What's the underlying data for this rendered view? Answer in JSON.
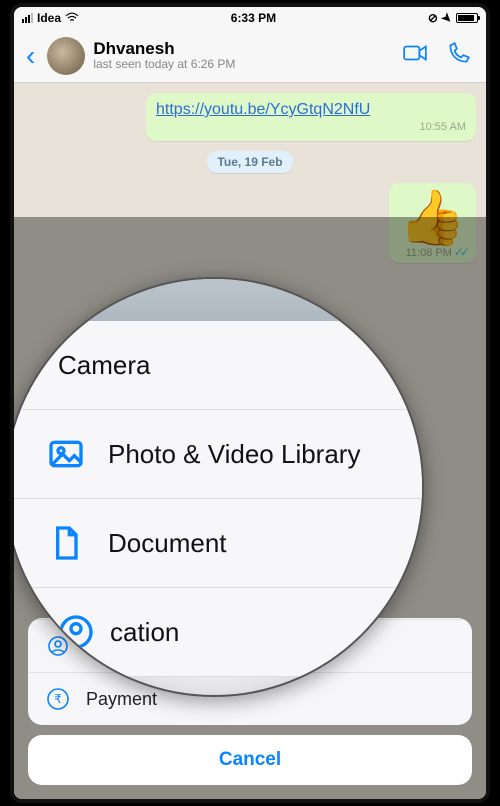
{
  "statusbar": {
    "carrier": "Idea",
    "time": "6:33 PM"
  },
  "chat": {
    "contact_name": "Dhvanesh",
    "last_seen": "last seen today at 6:26 PM",
    "link_text": "https://youtu.be/YcyGtqN2NfU",
    "link_time": "10:55 AM",
    "date_chip": "Tue, 19 Feb",
    "emoji": "👍",
    "emoji_time": "11:08 PM"
  },
  "magnifier": {
    "camera": "Camera",
    "library": "Photo & Video Library",
    "document": "Document",
    "location_partial": "cation"
  },
  "sheet": {
    "location": "Location",
    "payment": "Payment",
    "cancel": "Cancel"
  }
}
